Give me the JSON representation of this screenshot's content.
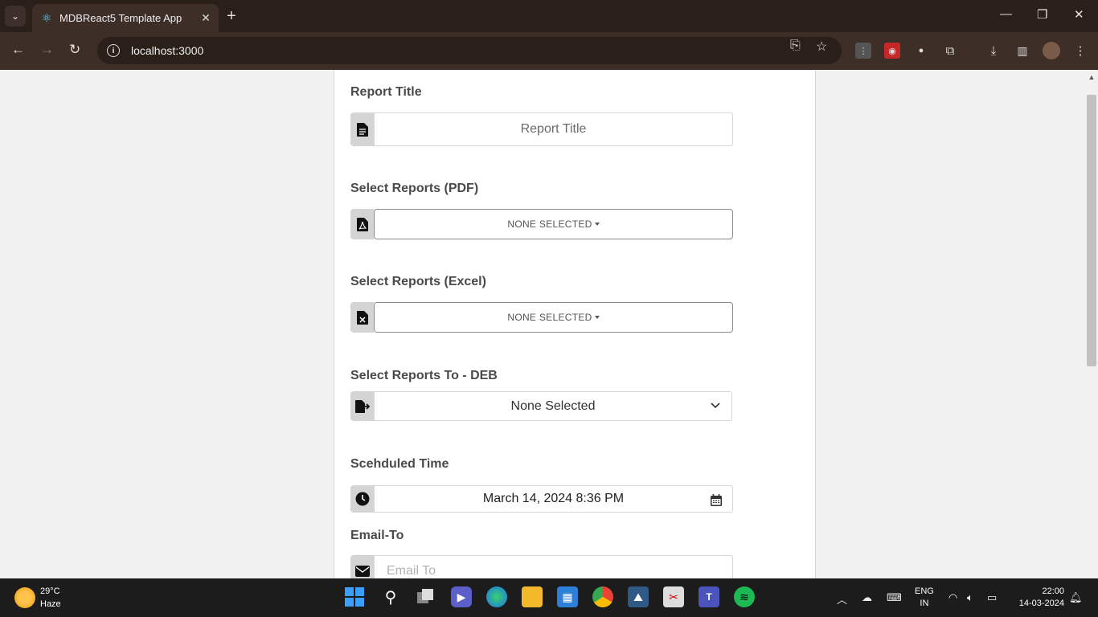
{
  "browser": {
    "tab_title": "MDBReact5 Template App",
    "tab_close": "✕",
    "new_tab": "+",
    "url": "localhost:3000"
  },
  "form": {
    "report_title": {
      "label": "Report Title",
      "placeholder": "Report Title"
    },
    "pdf": {
      "label": "Select Reports (PDF)",
      "value": "NONE SELECTED"
    },
    "excel": {
      "label": "Select Reports (Excel)",
      "value": "NONE SELECTED"
    },
    "deb": {
      "label": "Select Reports To - DEB",
      "value": "None Selected"
    },
    "schedule": {
      "label": "Scehduled Time",
      "value": "March 14, 2024 8:36 PM"
    },
    "email": {
      "label": "Email-To",
      "placeholder": "Email To"
    }
  },
  "taskbar": {
    "temperature": "29°C",
    "condition": "Haze",
    "lang_1": "ENG",
    "lang_2": "IN",
    "time": "22:00",
    "date": "14-03-2024"
  }
}
